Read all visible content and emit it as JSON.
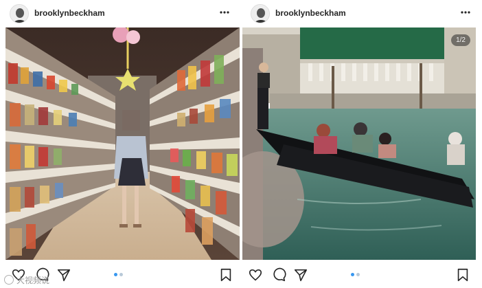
{
  "posts": [
    {
      "username": "brooklynbeckham",
      "photo_description": "",
      "counter": "",
      "icons": [
        "avatar",
        "more-icon",
        "heart-icon",
        "comment-icon",
        "share-icon",
        "bookmark-icon"
      ]
    },
    {
      "username": "brooklynbeckham",
      "photo_description": "",
      "counter": "1/2",
      "icons": [
        "avatar",
        "more-icon",
        "heart-icon",
        "comment-icon",
        "share-icon",
        "bookmark-icon"
      ]
    }
  ],
  "carousel": {
    "active_index": 1,
    "total": 2
  },
  "watermark": {
    "text": "大视频说"
  },
  "colors": {
    "accent": "#3897f0",
    "text": "#262626"
  }
}
